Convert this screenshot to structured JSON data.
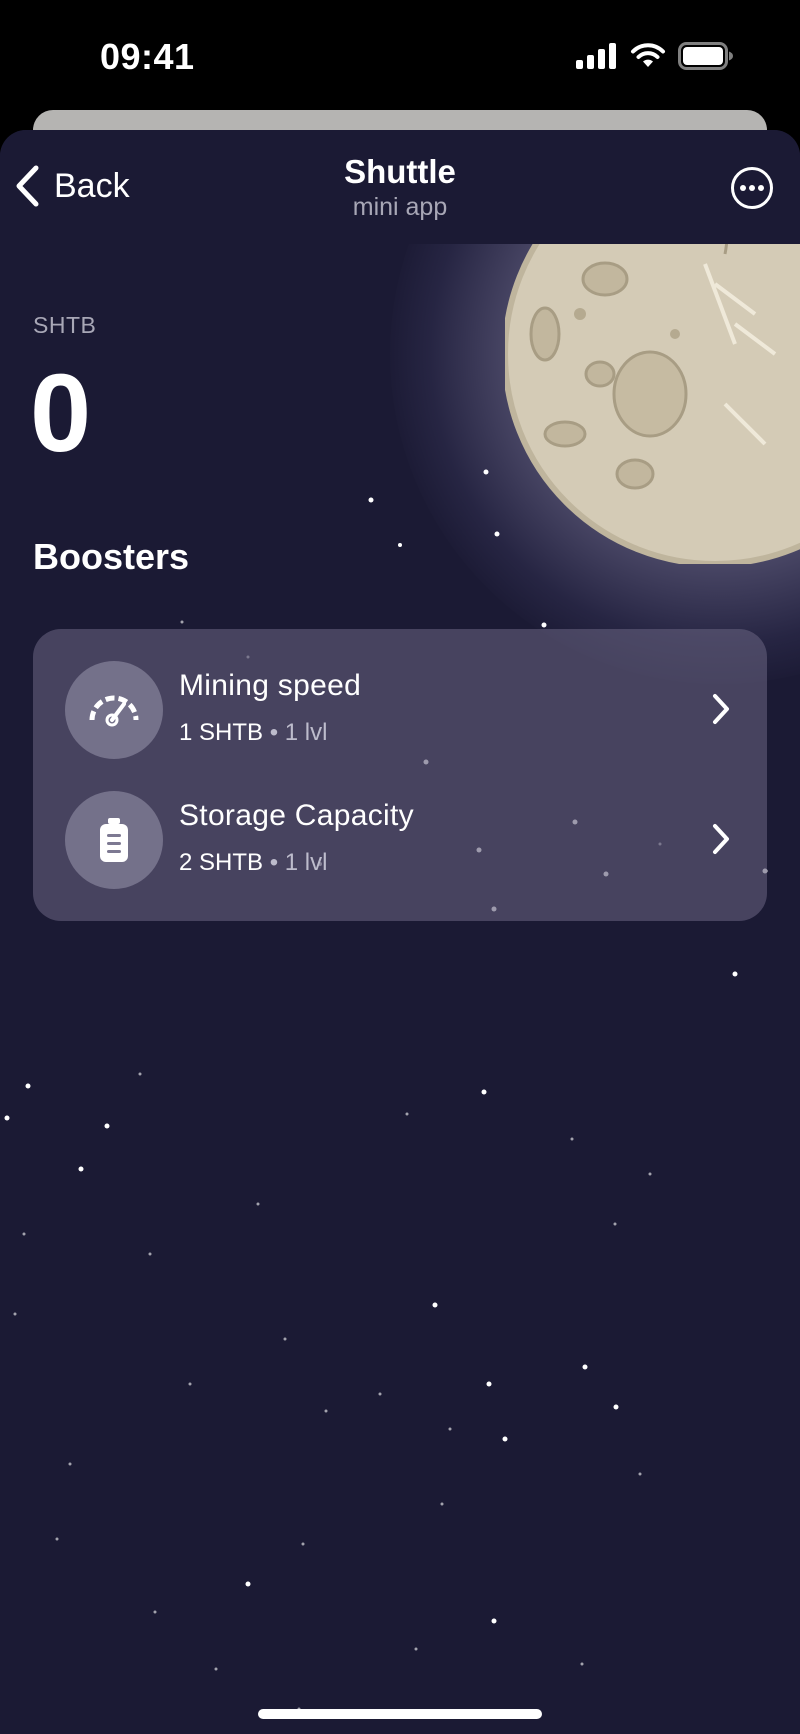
{
  "status_bar": {
    "time": "09:41"
  },
  "nav": {
    "back_label": "Back",
    "title": "Shuttle",
    "subtitle": "mini app"
  },
  "balance": {
    "currency": "SHTB",
    "amount": "0"
  },
  "boosters": {
    "title": "Boosters",
    "items": [
      {
        "name": "Mining speed",
        "price": "1 SHTB",
        "separator": "•",
        "level": "1 lvl",
        "icon": "speedometer-icon"
      },
      {
        "name": "Storage Capacity",
        "price": "2 SHTB",
        "separator": "•",
        "level": "1 lvl",
        "icon": "battery-icon"
      }
    ]
  },
  "colors": {
    "background": "#1b1a34",
    "card": "#4a475f",
    "moon": "#d4cbb6",
    "text_secondary": "#a8a7b6"
  }
}
